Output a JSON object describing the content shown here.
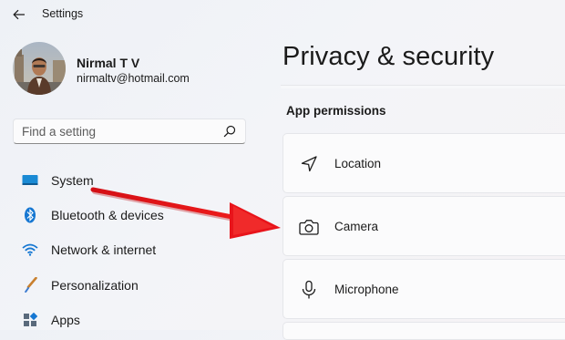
{
  "window": {
    "title": "Settings"
  },
  "profile": {
    "name": "Nirmal T V",
    "email": "nirmaltv@hotmail.com"
  },
  "search": {
    "placeholder": "Find a setting"
  },
  "sidebar": {
    "items": [
      {
        "label": "System",
        "icon": "system-monitor-icon"
      },
      {
        "label": "Bluetooth & devices",
        "icon": "bluetooth-icon"
      },
      {
        "label": "Network & internet",
        "icon": "wifi-icon"
      },
      {
        "label": "Personalization",
        "icon": "paintbrush-icon"
      },
      {
        "label": "Apps",
        "icon": "apps-icon"
      }
    ]
  },
  "main": {
    "title": "Privacy & security",
    "section_header": "App permissions",
    "permissions": [
      {
        "label": "Location",
        "icon": "location-icon"
      },
      {
        "label": "Camera",
        "icon": "camera-icon"
      },
      {
        "label": "Microphone",
        "icon": "microphone-icon"
      }
    ]
  },
  "colors": {
    "accent": "#0067c0",
    "annotation_arrow": "#e8141b",
    "card_background": "#fbfbfc",
    "window_background": "#f3f4f8"
  }
}
